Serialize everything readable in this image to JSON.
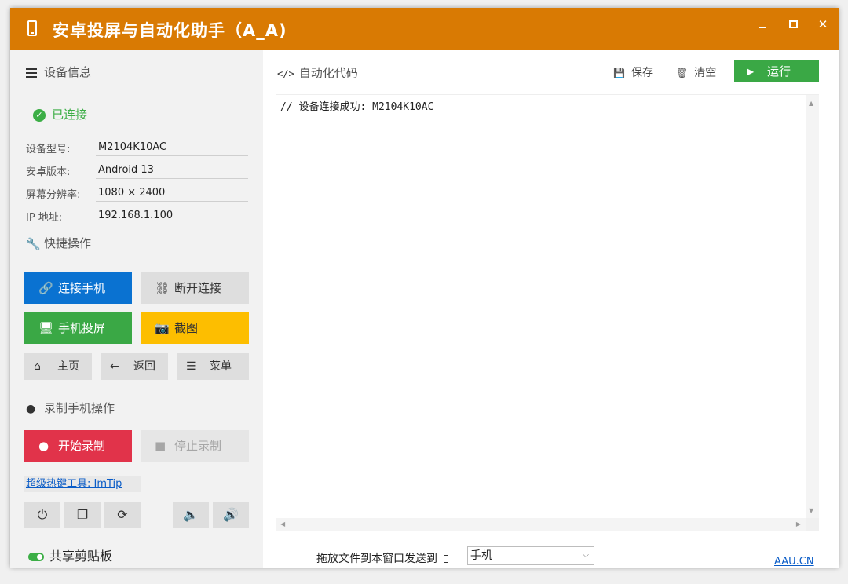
{
  "window": {
    "title": "安卓投屏与自动化助手（A_A)",
    "controls": {
      "minimize": "minimize",
      "maximize": "maximize",
      "close": "✕"
    }
  },
  "colors": {
    "titlebar": "#d97a03",
    "primary": "#0a72d1",
    "success": "#3aa845",
    "warning": "#fdbe00",
    "danger": "#e1334a"
  },
  "device_info": {
    "heading": "设备信息",
    "status": "已连接",
    "fields": [
      {
        "label": "设备型号:",
        "value": "M2104K10AC"
      },
      {
        "label": "安卓版本:",
        "value": "Android 13"
      },
      {
        "label": "屏幕分辨率:",
        "value": "1080 × 2400"
      },
      {
        "label": "IP 地址:",
        "value": "192.168.1.100"
      }
    ]
  },
  "quick_actions": {
    "heading": "快捷操作",
    "connect": "连接手机",
    "disconnect": "断开连接",
    "mirror": "手机投屏",
    "screenshot": "截图",
    "home": "主页",
    "back": "返回",
    "menu": "菜单"
  },
  "recording": {
    "heading": "录制手机操作",
    "start": "开始录制",
    "stop": "停止录制"
  },
  "hotkey_link": "超级热键工具: ImTip",
  "icon_buttons": [
    "power-icon",
    "copy-icon",
    "refresh-icon",
    "volume-down-icon",
    "volume-up-icon"
  ],
  "clipboard": {
    "label": "共享剪贴板",
    "enabled": true
  },
  "editor": {
    "heading": "自动化代码",
    "save": "保存",
    "clear": "清空",
    "run": "运行",
    "code": "// 设备连接成功: M2104K10AC"
  },
  "footer": {
    "drop_label": "拖放文件到本窗口发送到",
    "target_selected": "手机",
    "site_link": "AAU.CN"
  }
}
